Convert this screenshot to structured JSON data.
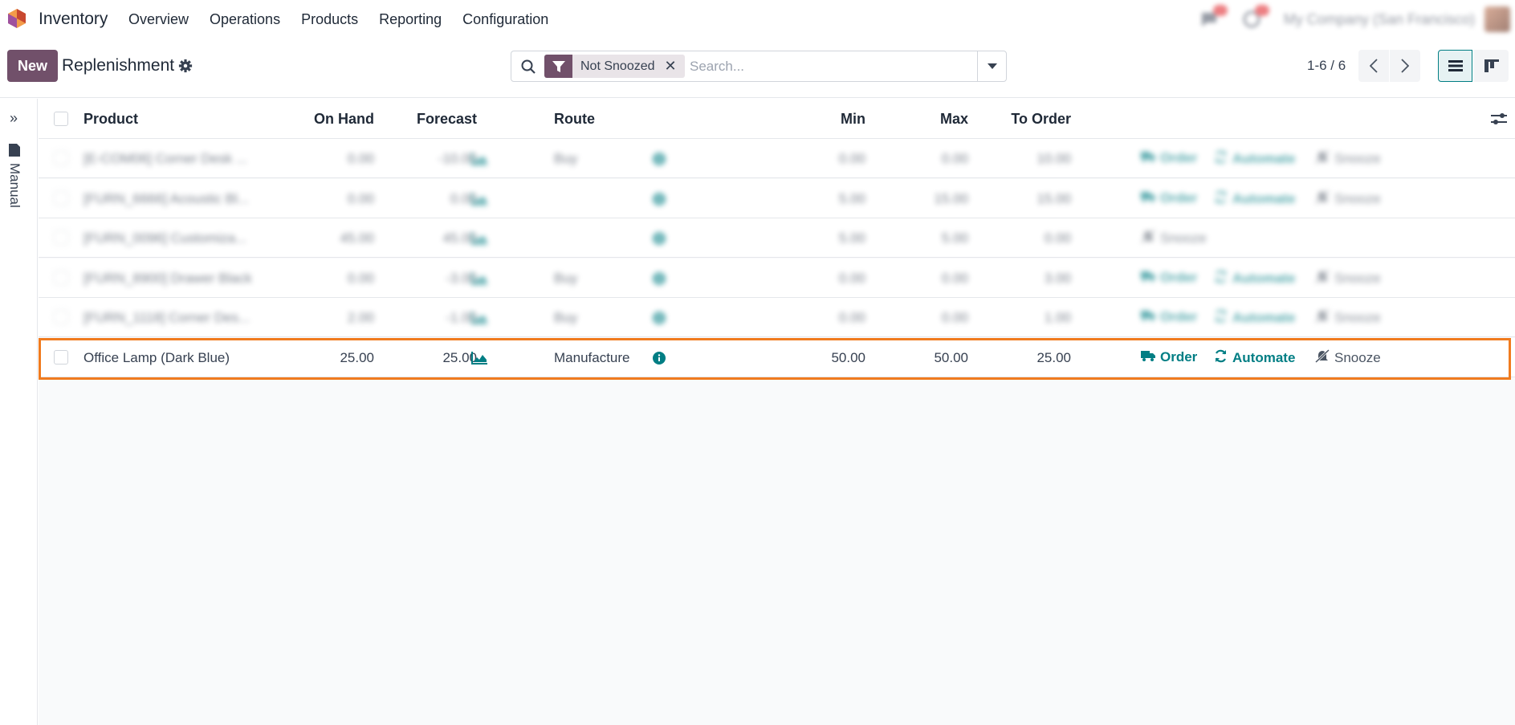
{
  "navbar": {
    "app_name": "Inventory",
    "menu": [
      "Overview",
      "Operations",
      "Products",
      "Reporting",
      "Configuration"
    ],
    "company": "My Company (San Francisco)"
  },
  "control": {
    "new_label": "New",
    "title": "Replenishment",
    "filter_facet": "Not Snoozed",
    "search_placeholder": "Search...",
    "pager": "1-6 / 6"
  },
  "sidebar": {
    "label": "Manual"
  },
  "table": {
    "headers": {
      "product": "Product",
      "on_hand": "On Hand",
      "forecast": "Forecast",
      "route": "Route",
      "min": "Min",
      "max": "Max",
      "to_order": "To Order"
    },
    "actions": {
      "order": "Order",
      "automate": "Automate",
      "snooze": "Snooze"
    },
    "rows": [
      {
        "product": "[E-COM06] Corner Desk ...",
        "on_hand": "0.00",
        "forecast": "-10.00",
        "route": "Buy",
        "min": "0.00",
        "max": "0.00",
        "to_order": "10.00"
      },
      {
        "product": "[FURN_6666] Acoustic Bl...",
        "on_hand": "0.00",
        "forecast": "0.00",
        "route": "",
        "min": "5.00",
        "max": "15.00",
        "to_order": "15.00"
      },
      {
        "product": "[FURN_0096] Customiza...",
        "on_hand": "45.00",
        "forecast": "45.00",
        "route": "",
        "min": "5.00",
        "max": "5.00",
        "to_order": "0.00"
      },
      {
        "product": "[FURN_8900] Drawer Black",
        "on_hand": "0.00",
        "forecast": "-3.00",
        "route": "Buy",
        "min": "0.00",
        "max": "0.00",
        "to_order": "3.00"
      },
      {
        "product": "[FURN_1118] Corner Des...",
        "on_hand": "2.00",
        "forecast": "-1.00",
        "route": "Buy",
        "min": "0.00",
        "max": "0.00",
        "to_order": "1.00"
      },
      {
        "product": "Office Lamp (Dark Blue)",
        "on_hand": "25.00",
        "forecast": "25.00",
        "route": "Manufacture",
        "min": "50.00",
        "max": "50.00",
        "to_order": "25.00"
      }
    ]
  },
  "colors": {
    "brand": "#71506a",
    "accent": "#017e84",
    "highlight": "#f07b1f"
  }
}
